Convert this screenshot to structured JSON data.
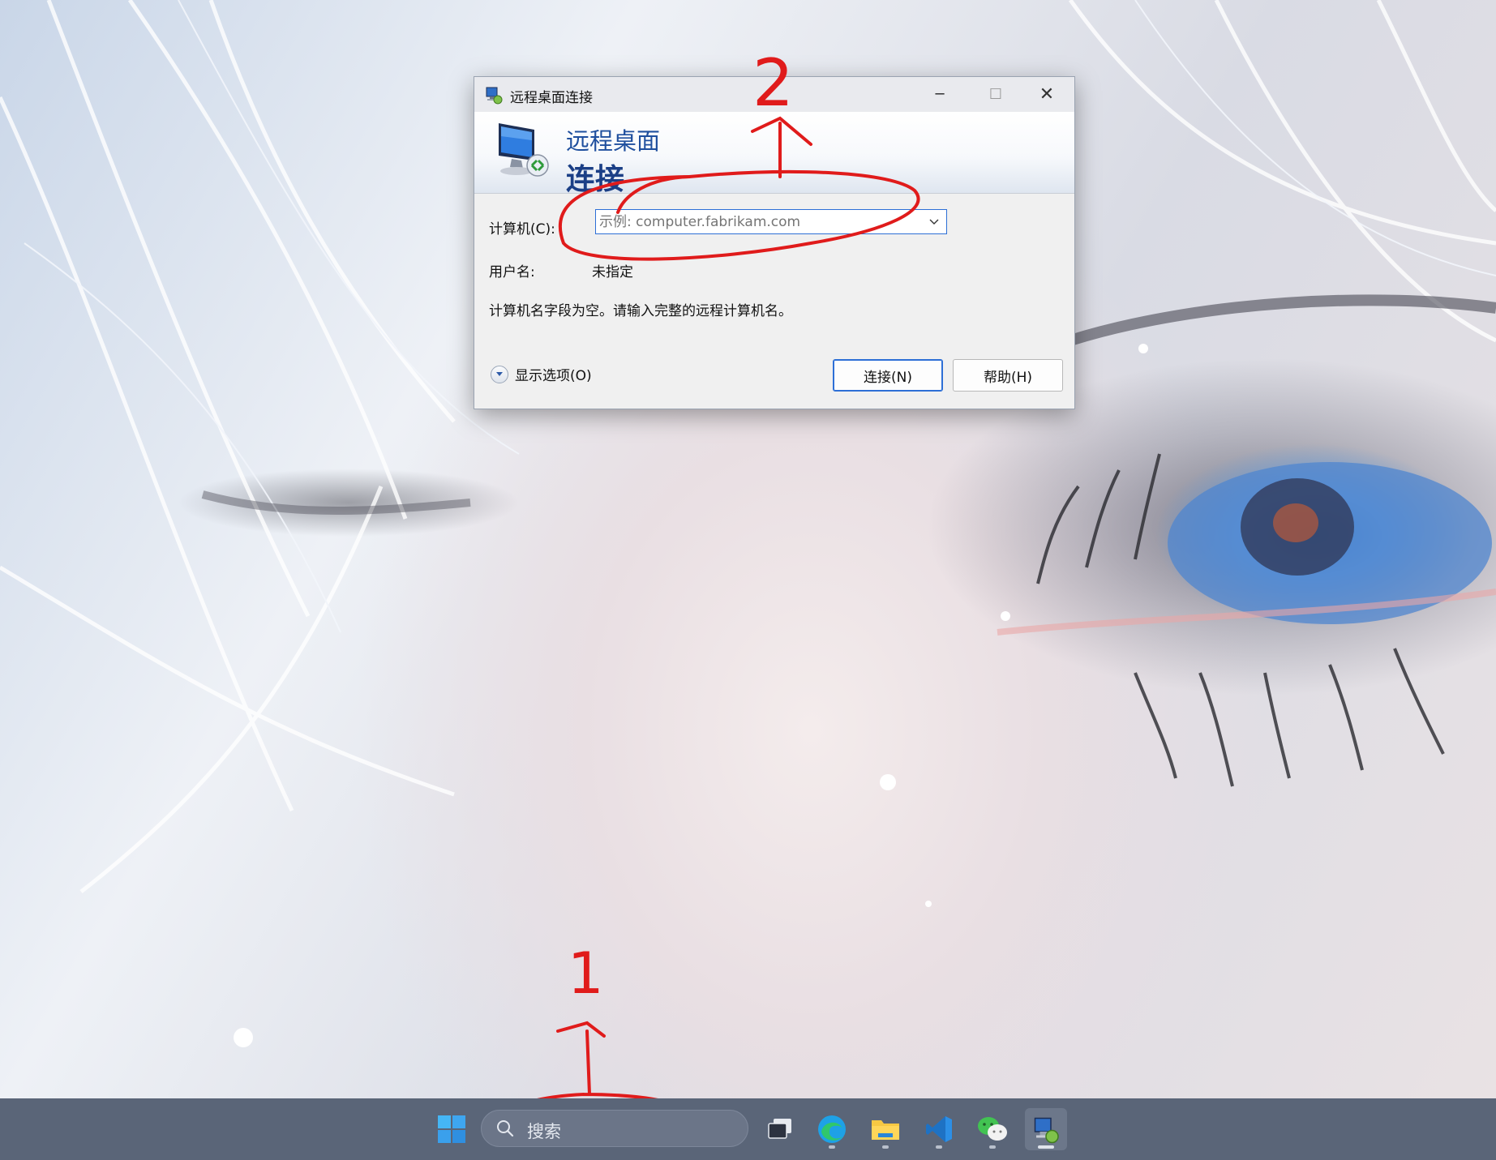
{
  "window": {
    "title": "远程桌面连接",
    "controls": {
      "minimize": "─",
      "maximize": "☐",
      "close": "✕"
    },
    "banner": {
      "line1": "远程桌面",
      "line2": "连接"
    },
    "computer": {
      "label": "计算机(C):",
      "placeholder": "示例: computer.fabrikam.com",
      "value": ""
    },
    "username": {
      "label": "用户名:",
      "value": "未指定"
    },
    "message": "计算机名字段为空。请输入完整的远程计算机名。",
    "show_options": "显示选项(O)",
    "buttons": {
      "connect": "连接(N)",
      "help": "帮助(H)"
    }
  },
  "annotations": {
    "mark_1": "1",
    "mark_2": "2"
  },
  "taskbar": {
    "search_label": "搜索",
    "apps": [
      "task-view",
      "edge",
      "file-explorer",
      "vscode",
      "wechat",
      "remote-desktop"
    ]
  },
  "colors": {
    "annotation": "#e01b1b",
    "accent": "#2d6fd6",
    "taskbar": "#5a6578"
  }
}
